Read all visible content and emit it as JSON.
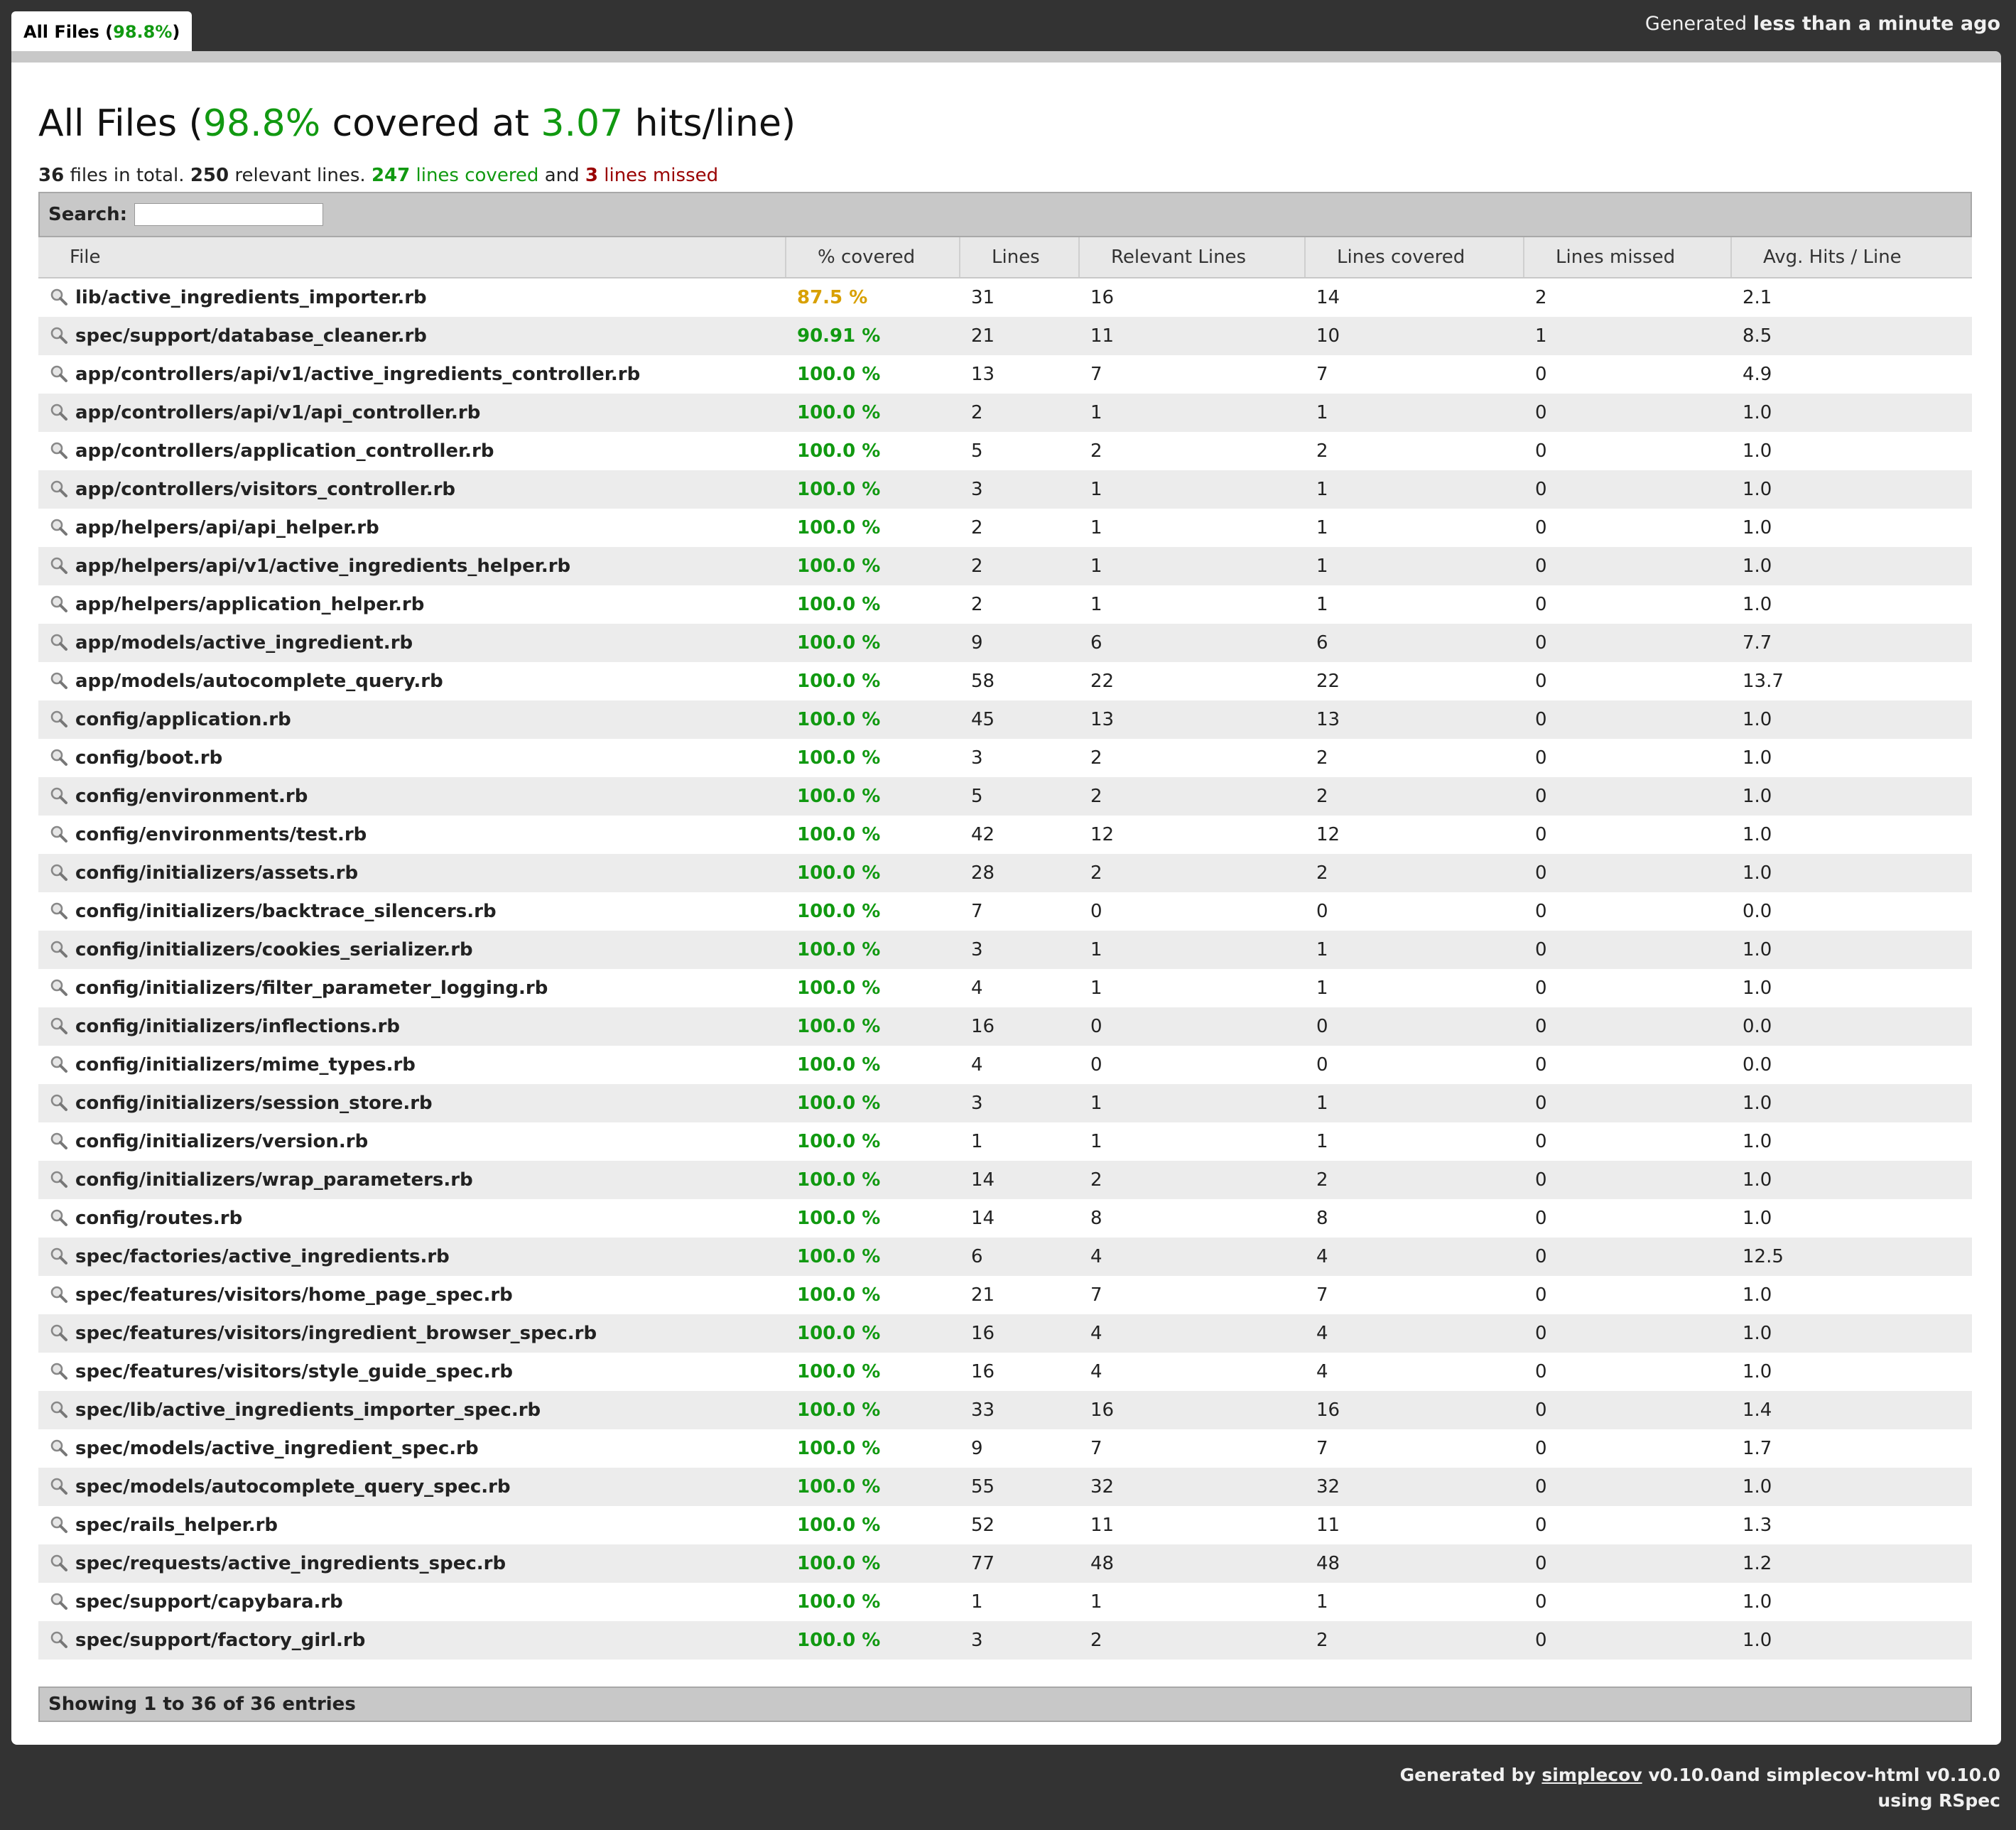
{
  "tab": {
    "label": "All Files",
    "pct": "98.8%"
  },
  "generated_top": {
    "prefix": "Generated",
    "when": "less than a minute ago"
  },
  "heading": {
    "prefix": "All Files (",
    "pct": "98.8%",
    "mid": " covered at ",
    "hits": "3.07",
    "suffix": " hits/line)"
  },
  "summary": {
    "files": "36",
    "files_text": " files in total. ",
    "relevant": "250",
    "relevant_text": " relevant lines. ",
    "covered": "247",
    "covered_text": " lines covered",
    "and_text": " and ",
    "missed": "3",
    "missed_text": " lines missed"
  },
  "search": {
    "label": "Search:",
    "value": ""
  },
  "columns": [
    "File",
    "% covered",
    "Lines",
    "Relevant Lines",
    "Lines covered",
    "Lines missed",
    "Avg. Hits / Line"
  ],
  "rows": [
    [
      "lib/active_ingredients_importer.rb",
      "87.5 %",
      "31",
      "16",
      "14",
      "2",
      "2.1"
    ],
    [
      "spec/support/database_cleaner.rb",
      "90.91 %",
      "21",
      "11",
      "10",
      "1",
      "8.5"
    ],
    [
      "app/controllers/api/v1/active_ingredients_controller.rb",
      "100.0 %",
      "13",
      "7",
      "7",
      "0",
      "4.9"
    ],
    [
      "app/controllers/api/v1/api_controller.rb",
      "100.0 %",
      "2",
      "1",
      "1",
      "0",
      "1.0"
    ],
    [
      "app/controllers/application_controller.rb",
      "100.0 %",
      "5",
      "2",
      "2",
      "0",
      "1.0"
    ],
    [
      "app/controllers/visitors_controller.rb",
      "100.0 %",
      "3",
      "1",
      "1",
      "0",
      "1.0"
    ],
    [
      "app/helpers/api/api_helper.rb",
      "100.0 %",
      "2",
      "1",
      "1",
      "0",
      "1.0"
    ],
    [
      "app/helpers/api/v1/active_ingredients_helper.rb",
      "100.0 %",
      "2",
      "1",
      "1",
      "0",
      "1.0"
    ],
    [
      "app/helpers/application_helper.rb",
      "100.0 %",
      "2",
      "1",
      "1",
      "0",
      "1.0"
    ],
    [
      "app/models/active_ingredient.rb",
      "100.0 %",
      "9",
      "6",
      "6",
      "0",
      "7.7"
    ],
    [
      "app/models/autocomplete_query.rb",
      "100.0 %",
      "58",
      "22",
      "22",
      "0",
      "13.7"
    ],
    [
      "config/application.rb",
      "100.0 %",
      "45",
      "13",
      "13",
      "0",
      "1.0"
    ],
    [
      "config/boot.rb",
      "100.0 %",
      "3",
      "2",
      "2",
      "0",
      "1.0"
    ],
    [
      "config/environment.rb",
      "100.0 %",
      "5",
      "2",
      "2",
      "0",
      "1.0"
    ],
    [
      "config/environments/test.rb",
      "100.0 %",
      "42",
      "12",
      "12",
      "0",
      "1.0"
    ],
    [
      "config/initializers/assets.rb",
      "100.0 %",
      "28",
      "2",
      "2",
      "0",
      "1.0"
    ],
    [
      "config/initializers/backtrace_silencers.rb",
      "100.0 %",
      "7",
      "0",
      "0",
      "0",
      "0.0"
    ],
    [
      "config/initializers/cookies_serializer.rb",
      "100.0 %",
      "3",
      "1",
      "1",
      "0",
      "1.0"
    ],
    [
      "config/initializers/filter_parameter_logging.rb",
      "100.0 %",
      "4",
      "1",
      "1",
      "0",
      "1.0"
    ],
    [
      "config/initializers/inflections.rb",
      "100.0 %",
      "16",
      "0",
      "0",
      "0",
      "0.0"
    ],
    [
      "config/initializers/mime_types.rb",
      "100.0 %",
      "4",
      "0",
      "0",
      "0",
      "0.0"
    ],
    [
      "config/initializers/session_store.rb",
      "100.0 %",
      "3",
      "1",
      "1",
      "0",
      "1.0"
    ],
    [
      "config/initializers/version.rb",
      "100.0 %",
      "1",
      "1",
      "1",
      "0",
      "1.0"
    ],
    [
      "config/initializers/wrap_parameters.rb",
      "100.0 %",
      "14",
      "2",
      "2",
      "0",
      "1.0"
    ],
    [
      "config/routes.rb",
      "100.0 %",
      "14",
      "8",
      "8",
      "0",
      "1.0"
    ],
    [
      "spec/factories/active_ingredients.rb",
      "100.0 %",
      "6",
      "4",
      "4",
      "0",
      "12.5"
    ],
    [
      "spec/features/visitors/home_page_spec.rb",
      "100.0 %",
      "21",
      "7",
      "7",
      "0",
      "1.0"
    ],
    [
      "spec/features/visitors/ingredient_browser_spec.rb",
      "100.0 %",
      "16",
      "4",
      "4",
      "0",
      "1.0"
    ],
    [
      "spec/features/visitors/style_guide_spec.rb",
      "100.0 %",
      "16",
      "4",
      "4",
      "0",
      "1.0"
    ],
    [
      "spec/lib/active_ingredients_importer_spec.rb",
      "100.0 %",
      "33",
      "16",
      "16",
      "0",
      "1.4"
    ],
    [
      "spec/models/active_ingredient_spec.rb",
      "100.0 %",
      "9",
      "7",
      "7",
      "0",
      "1.7"
    ],
    [
      "spec/models/autocomplete_query_spec.rb",
      "100.0 %",
      "55",
      "32",
      "32",
      "0",
      "1.0"
    ],
    [
      "spec/rails_helper.rb",
      "100.0 %",
      "52",
      "11",
      "11",
      "0",
      "1.3"
    ],
    [
      "spec/requests/active_ingredients_spec.rb",
      "100.0 %",
      "77",
      "48",
      "48",
      "0",
      "1.2"
    ],
    [
      "spec/support/capybara.rb",
      "100.0 %",
      "1",
      "1",
      "1",
      "0",
      "1.0"
    ],
    [
      "spec/support/factory_girl.rb",
      "100.0 %",
      "3",
      "2",
      "2",
      "0",
      "1.0"
    ]
  ],
  "row_icon": "magnifier-icon",
  "info": "Showing 1 to 36 of 36 entries",
  "generated_bottom": {
    "prefix": "Generated by ",
    "link": "simplecov",
    "suffix": " v0.10.0and simplecov-html v0.10.0",
    "line2": "using RSpec"
  },
  "colors": {
    "good": "#119911",
    "ok": "#d8a000",
    "missed": "#990000",
    "background": "#333333"
  }
}
